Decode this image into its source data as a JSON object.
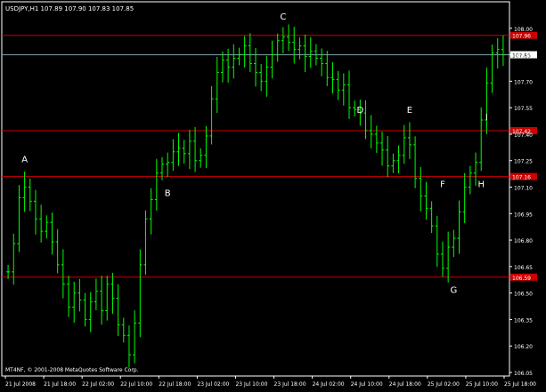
{
  "header": {
    "symbol_label": "USDJPY,H1  107.89 107.90 107.83 107.85"
  },
  "footer": {
    "copyright": "MT4NF, © 2001-2008 MetaQuotes Software Corp."
  },
  "colors": {
    "background": "#000000",
    "bars": "#00ff00",
    "level_lines": "#cc0000",
    "price_line": "#7f9fb0",
    "axis_text": "#ffffff",
    "level_tag": "#cc0000"
  },
  "chart_data": {
    "type": "bar",
    "symbol": "USDJPY",
    "timeframe": "H1",
    "ylim": [
      106.03,
      108.15
    ],
    "yticks": [
      "108.00",
      "107.85",
      "107.70",
      "107.55",
      "107.40",
      "107.25",
      "107.10",
      "106.95",
      "106.80",
      "106.65",
      "106.50",
      "106.35",
      "106.20",
      "106.05"
    ],
    "xticks": [
      "21 Jul 2008",
      "21 Jul 18:00",
      "22 Jul 02:00",
      "22 Jul 10:00",
      "22 Jul 18:00",
      "23 Jul 02:00",
      "23 Jul 10:00",
      "23 Jul 18:00",
      "24 Jul 02:00",
      "24 Jul 10:00",
      "24 Jul 18:00",
      "25 Jul 02:00",
      "25 Jul 10:00",
      "25 Jul 18:00"
    ],
    "current_price": "107.85",
    "levels": [
      {
        "price": 107.96,
        "tag": "107.96"
      },
      {
        "price": 107.42,
        "tag": "107.42"
      },
      {
        "price": 107.16,
        "tag": "107.16"
      },
      {
        "price": 106.59,
        "tag": "106.59"
      }
    ],
    "point_labels": [
      {
        "label": "A",
        "bar": 3,
        "price": 107.24
      },
      {
        "label": "B",
        "bar": 29,
        "price": 107.05
      },
      {
        "label": "C",
        "bar": 50,
        "price": 108.05
      },
      {
        "label": "D",
        "bar": 64,
        "price": 107.52
      },
      {
        "label": "E",
        "bar": 73,
        "price": 107.52
      },
      {
        "label": "F",
        "bar": 79,
        "price": 107.1
      },
      {
        "label": "G",
        "bar": 81,
        "price": 106.5
      },
      {
        "label": "H",
        "bar": 86,
        "price": 107.1
      },
      {
        "label": "I",
        "bar": 87,
        "price": 107.48
      }
    ],
    "closes": [
      106.62,
      106.78,
      107.04,
      107.1,
      107.02,
      106.92,
      106.85,
      106.9,
      106.79,
      106.66,
      106.55,
      106.42,
      106.5,
      106.46,
      106.35,
      106.45,
      106.51,
      106.4,
      106.55,
      106.47,
      106.32,
      106.26,
      106.15,
      106.33,
      106.66,
      106.92,
      107.03,
      107.18,
      107.23,
      107.24,
      107.3,
      107.32,
      107.29,
      107.36,
      107.25,
      107.28,
      107.39,
      107.6,
      107.75,
      107.82,
      107.78,
      107.83,
      107.85,
      107.9,
      107.8,
      107.75,
      107.7,
      107.78,
      107.85,
      107.93,
      107.95,
      107.92,
      107.88,
      107.9,
      107.84,
      107.87,
      107.83,
      107.8,
      107.72,
      107.71,
      107.65,
      107.68,
      107.55,
      107.54,
      107.52,
      107.42,
      107.4,
      107.35,
      107.31,
      107.22,
      107.25,
      107.28,
      107.38,
      107.34,
      107.15,
      107.05,
      106.98,
      106.88,
      106.72,
      106.64,
      106.76,
      106.81,
      106.96,
      107.1,
      107.18,
      107.24,
      107.48,
      107.69,
      107.86,
      107.88,
      107.85
    ]
  }
}
